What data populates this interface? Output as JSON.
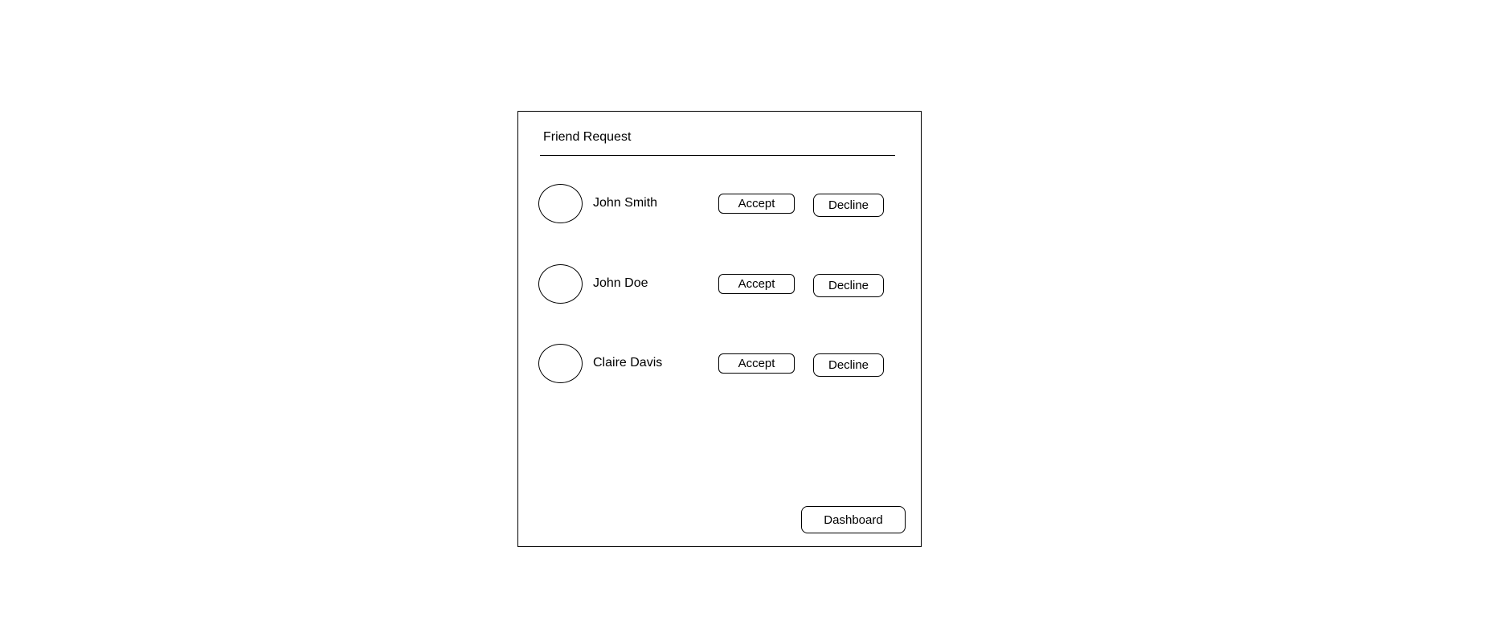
{
  "panel": {
    "title": "Friend Request"
  },
  "requests": [
    {
      "name": "John Smith",
      "accept_label": "Accept",
      "decline_label": "Decline"
    },
    {
      "name": "John Doe",
      "accept_label": "Accept",
      "decline_label": "Decline"
    },
    {
      "name": "Claire Davis",
      "accept_label": "Accept",
      "decline_label": "Decline"
    }
  ],
  "footer": {
    "dashboard_label": "Dashboard"
  }
}
